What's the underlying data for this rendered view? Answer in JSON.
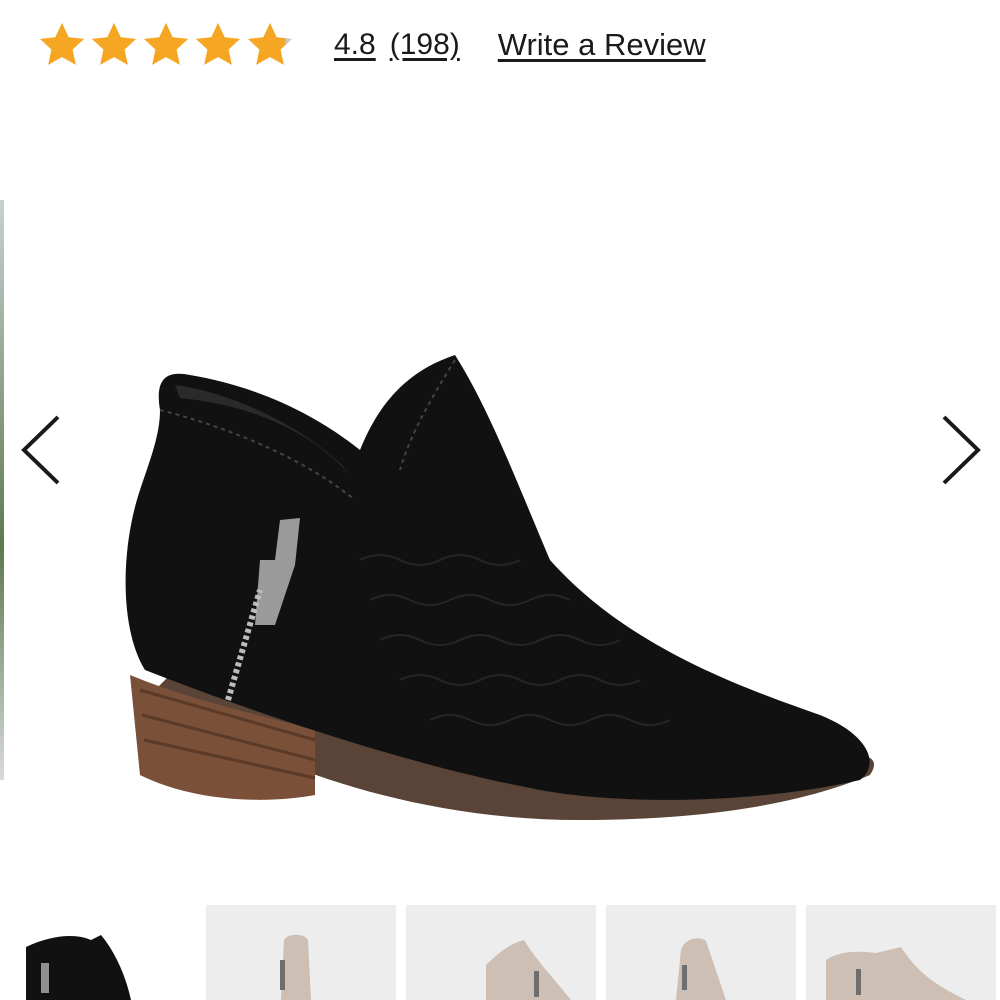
{
  "rating": {
    "value": "4.8",
    "count": "(198)",
    "stars": 5,
    "star_color": "#f5a623",
    "star_icon": "star-icon"
  },
  "review_link": {
    "label": "Write a Review"
  },
  "gallery": {
    "prev_icon": "chevron-left-icon",
    "next_icon": "chevron-right-icon",
    "image": "black-suede-ankle-bootie-with-side-zipper"
  },
  "thumbnails": [
    {
      "name": "black-bootie-thumbnail",
      "color": "#111111",
      "selected": true
    },
    {
      "name": "taupe-bootie-thumbnail-1",
      "color": "#cdbfb3",
      "selected": false
    },
    {
      "name": "taupe-bootie-thumbnail-2",
      "color": "#cdbfb3",
      "selected": false
    },
    {
      "name": "taupe-bootie-thumbnail-3",
      "color": "#cdbfb3",
      "selected": false
    },
    {
      "name": "taupe-bootie-thumbnail-4",
      "color": "#cdbfb3",
      "selected": false
    }
  ]
}
